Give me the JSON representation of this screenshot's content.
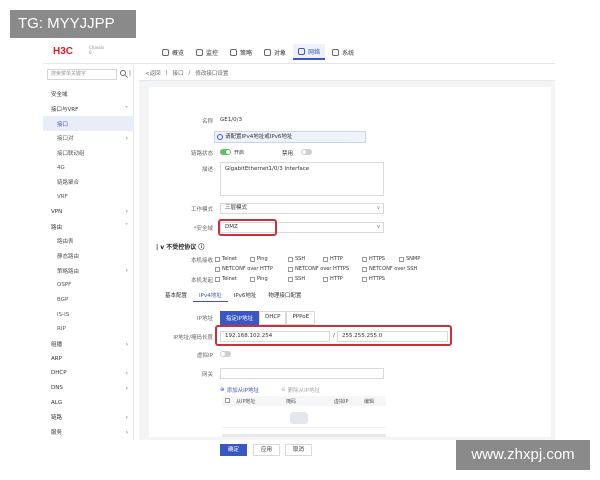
{
  "watermarks": {
    "top": "TG: MYYJJPP",
    "bottom": "www.zhxpj.com"
  },
  "brand": {
    "logo": "H3C",
    "sub_line1": "Chassis",
    "sub_line2": "0"
  },
  "nav": [
    {
      "label": "概览",
      "icon": "overview-icon"
    },
    {
      "label": "监控",
      "icon": "monitor-icon"
    },
    {
      "label": "策略",
      "icon": "policy-icon"
    },
    {
      "label": "对象",
      "icon": "object-icon"
    },
    {
      "label": "网络",
      "icon": "network-icon",
      "active": true
    },
    {
      "label": "系统",
      "icon": "system-icon"
    }
  ],
  "sidebar": {
    "search_placeholder": "搜索菜单关键字",
    "items": [
      {
        "label": "安全域",
        "level": 1
      },
      {
        "label": "接口与VRF",
        "level": 1,
        "chevron": "v"
      },
      {
        "label": "接口",
        "level": 2,
        "active": true
      },
      {
        "label": "接口对",
        "level": 2,
        "chevron": ">"
      },
      {
        "label": "接口联动组",
        "level": 2
      },
      {
        "label": "4G",
        "level": 2
      },
      {
        "label": "链路聚合",
        "level": 2
      },
      {
        "label": "VRF",
        "level": 2
      },
      {
        "label": "VPN",
        "level": 1,
        "chevron": ">"
      },
      {
        "label": "路由",
        "level": 1,
        "chevron": "v"
      },
      {
        "label": "路由表",
        "level": 2
      },
      {
        "label": "静态路由",
        "level": 2
      },
      {
        "label": "策略路由",
        "level": 2,
        "chevron": ">"
      },
      {
        "label": "OSPF",
        "level": 2
      },
      {
        "label": "BGP",
        "level": 2
      },
      {
        "label": "IS-IS",
        "level": 2
      },
      {
        "label": "RIP",
        "level": 2
      },
      {
        "label": "组播",
        "level": 1,
        "chevron": ">"
      },
      {
        "label": "ARP",
        "level": 1
      },
      {
        "label": "DHCP",
        "level": 1,
        "chevron": ">"
      },
      {
        "label": "DNS",
        "level": 1,
        "chevron": ">"
      },
      {
        "label": "ALG",
        "level": 1
      },
      {
        "label": "链路",
        "level": 1,
        "chevron": ">"
      },
      {
        "label": "服务",
        "level": 1,
        "chevron": ">"
      }
    ]
  },
  "breadcrumb": {
    "back": "<返回",
    "sep": "|",
    "level1": "接口",
    "level2": "修改接口设置"
  },
  "form": {
    "name_label": "名称",
    "name_value": "GE1/0/3",
    "alert_text": "请配置IPv4地址或IPv6地址",
    "link_status_label": "链路状态",
    "link_status_on": "开启",
    "link_status_off": "禁用",
    "desc_label": "描述",
    "desc_value": "GigabitEthernet1/0/3 Interface",
    "work_mode_label": "工作模式",
    "work_mode_value": "三层模式",
    "zone_label": "*安全域",
    "zone_value": "DMZ",
    "protocol_title": "不受控协议",
    "local_recv_label": "本机接收",
    "local_send_label": "本机发起",
    "proto_row1": [
      "Telnet",
      "Ping",
      "SSH",
      "HTTP",
      "HTTPS",
      "SNMP"
    ],
    "proto_row2": [
      "NETCONF over HTTP",
      "NETCONF over HTTPS",
      "NETCONF over SSH"
    ],
    "proto_row3": [
      "Telnet",
      "Ping",
      "SSH",
      "HTTP",
      "HTTPS"
    ]
  },
  "tabs": [
    "基本配置",
    "IPv4地址",
    "IPv6地址",
    "物理接口配置"
  ],
  "ipv4": {
    "ip_label": "IP地址",
    "modes": [
      "指定IP地址",
      "DHCP",
      "PPPoE"
    ],
    "addr_label": "IP地址/掩码长度",
    "ip_value": "192.168.102.254",
    "slash": "/",
    "mask_value": "255.255.255.0",
    "virtual_ip_label": "虚拟IP",
    "gateway_label": "网关",
    "add_slave": "添加从IP地址",
    "del_slave": "删除从IP地址",
    "table_headers": [
      "从IP地址",
      "掩码",
      "虚拟IP",
      "编辑"
    ]
  },
  "buttons": {
    "ok": "确定",
    "apply": "应用",
    "cancel": "取消"
  },
  "colors": {
    "accent": "#3b57c4",
    "highlight_box": "#c8323a",
    "toggle_on": "#5fc15d"
  }
}
